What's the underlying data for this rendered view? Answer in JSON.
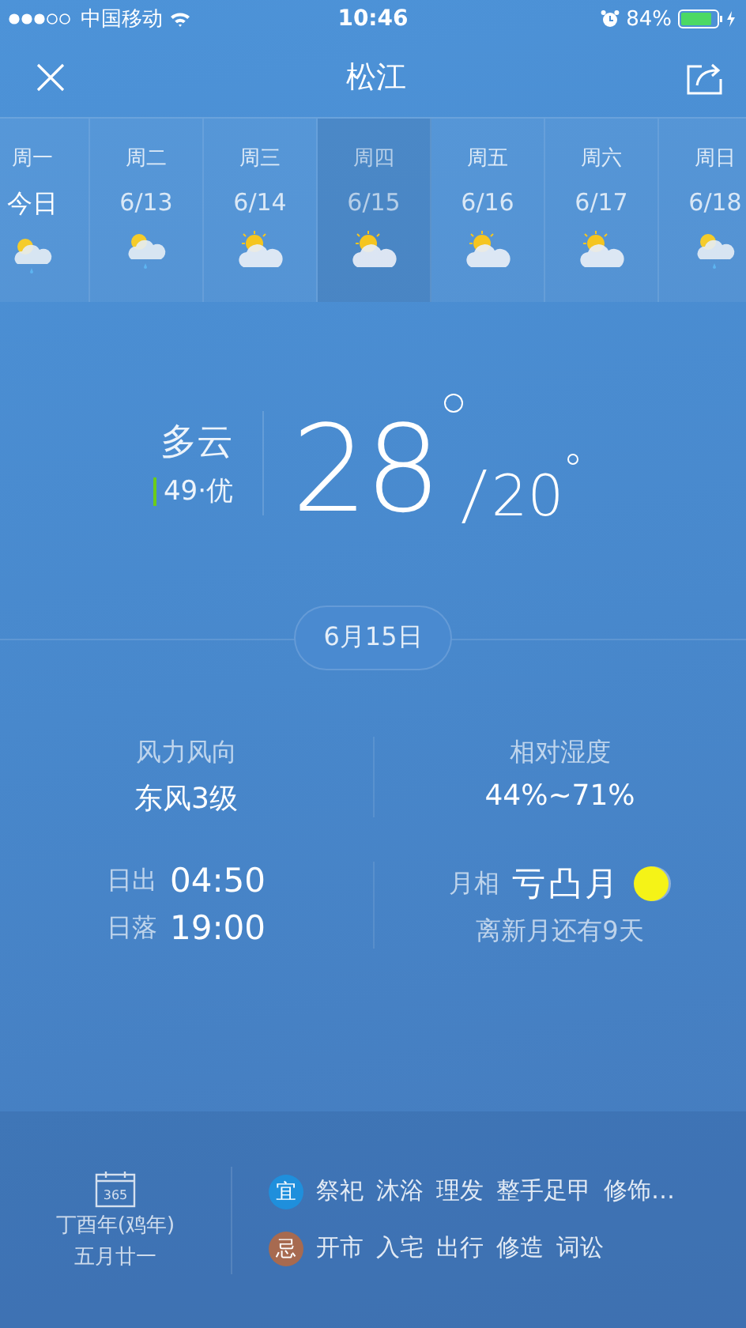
{
  "status_bar": {
    "carrier": "中国移动",
    "time": "10:46",
    "battery": "84%"
  },
  "nav": {
    "title": "松江"
  },
  "days": [
    {
      "weekday": "周一",
      "date": "今日",
      "today": true,
      "selected": false,
      "kind": "shower"
    },
    {
      "weekday": "周二",
      "date": "6/13",
      "today": false,
      "selected": false,
      "kind": "shower"
    },
    {
      "weekday": "周三",
      "date": "6/14",
      "today": false,
      "selected": false,
      "kind": "partly"
    },
    {
      "weekday": "周四",
      "date": "6/15",
      "today": false,
      "selected": true,
      "kind": "partly"
    },
    {
      "weekday": "周五",
      "date": "6/16",
      "today": false,
      "selected": false,
      "kind": "partly"
    },
    {
      "weekday": "周六",
      "date": "6/17",
      "today": false,
      "selected": false,
      "kind": "partly"
    },
    {
      "weekday": "周日",
      "date": "6/18",
      "today": false,
      "selected": false,
      "kind": "shower"
    }
  ],
  "current": {
    "condition": "多云",
    "aqi": "49·优",
    "high": "28",
    "low": "20"
  },
  "date_pill": "6月15日",
  "details": {
    "wind_label": "风力风向",
    "wind_value": "东风3级",
    "humidity_label": "相对湿度",
    "humidity_value": "44%~71%",
    "sunrise_label": "日出",
    "sunrise": "04:50",
    "sunset_label": "日落",
    "sunset": "19:00",
    "moon_label": "月相",
    "moon_phase": "亏凸月",
    "new_moon": "离新月还有9天"
  },
  "almanac": {
    "icon_text": "365",
    "year": "丁酉年(鸡年)",
    "lunar_date": "五月廿一",
    "rows": [
      {
        "kind": "good",
        "badge": "宜",
        "items": [
          "祭祀",
          "沐浴",
          "理发",
          "整手足甲",
          "修饰…"
        ]
      },
      {
        "kind": "bad",
        "badge": "忌",
        "items": [
          "开市",
          "入宅",
          "出行",
          "修造",
          "词讼"
        ]
      }
    ]
  }
}
